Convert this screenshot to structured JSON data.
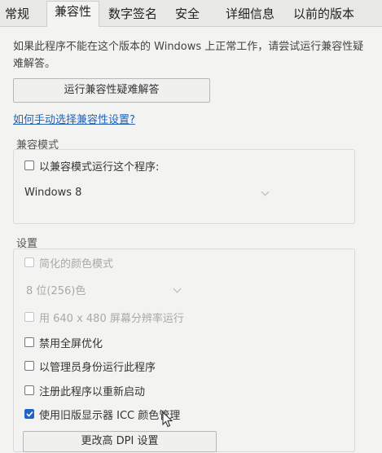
{
  "tabs": [
    {
      "label": "常规"
    },
    {
      "label": "兼容性"
    },
    {
      "label": "数字签名"
    },
    {
      "label": "安全"
    },
    {
      "label": "详细信息"
    },
    {
      "label": "以前的版本"
    }
  ],
  "active_tab": "兼容性",
  "description": "如果此程序不能在这个版本的 Windows 上正常工作，请尝试运行兼容性疑难解答。",
  "troubleshoot_button": "运行兼容性疑难解答",
  "manual_link": "如何手动选择兼容性设置?",
  "compat_mode": {
    "title": "兼容模式",
    "checkbox_label": "以兼容模式运行这个程序:",
    "checked": false,
    "select_value": "Windows 8"
  },
  "settings": {
    "title": "设置",
    "reduced_color": {
      "label": "简化的颜色模式",
      "checked": false,
      "disabled": true
    },
    "color_select": "8 位(256)色",
    "resolution": {
      "label": "用 640 x 480 屏幕分辨率运行",
      "checked": false,
      "disabled": true
    },
    "fullscreen_opt": {
      "label": "禁用全屏优化",
      "checked": false
    },
    "run_as_admin": {
      "label": "以管理员身份运行此程序",
      "checked": false
    },
    "register_restart": {
      "label": "注册此程序以重新启动",
      "checked": false
    },
    "legacy_icc": {
      "label": "使用旧版显示器 ICC 颜色管理",
      "checked": true
    },
    "dpi_button": "更改高 DPI 设置"
  },
  "colors": {
    "accent": "#1e66c8",
    "link": "#2463b8"
  }
}
